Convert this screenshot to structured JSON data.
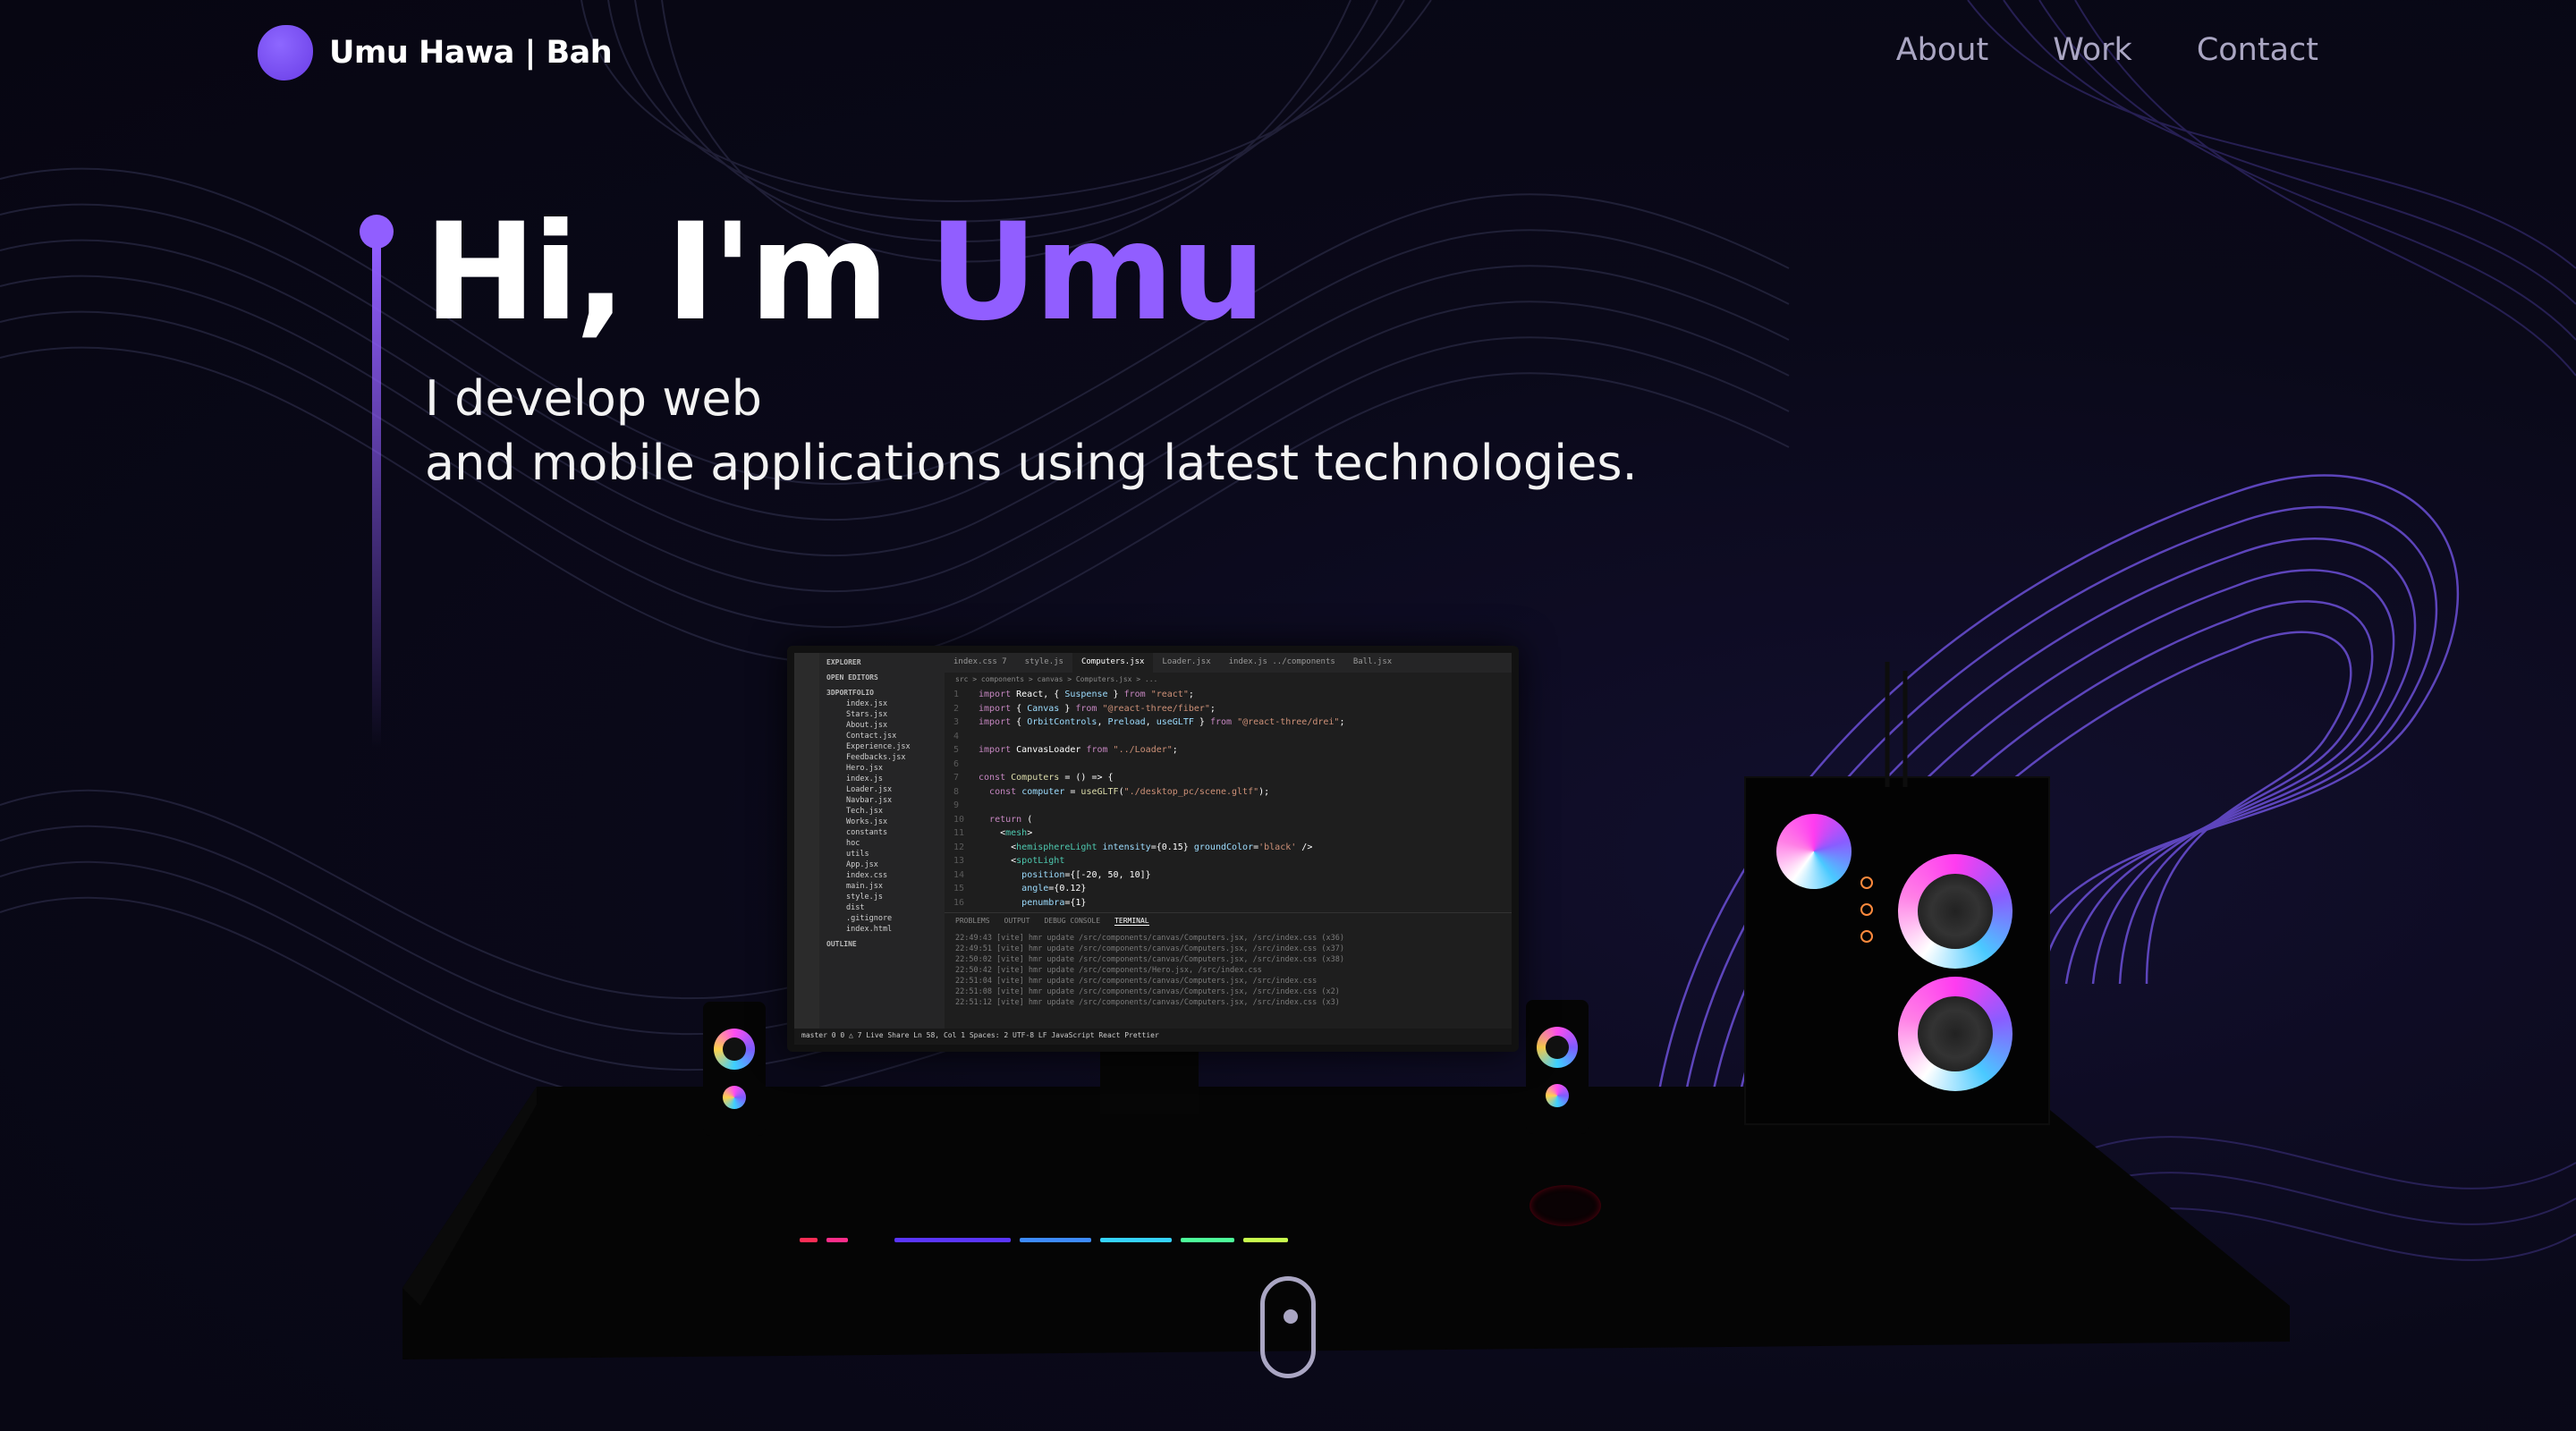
{
  "nav": {
    "logo_text": "Umu Hawa | Bah",
    "links": [
      "About",
      "Work",
      "Contact"
    ]
  },
  "hero": {
    "greeting": "Hi, I'm ",
    "name": "Umu",
    "subtitle_line1": "I develop web",
    "subtitle_line2": "and mobile applications using latest technologies."
  },
  "editor": {
    "tabs": [
      "index.css 7",
      "style.js",
      "Computers.jsx",
      "Loader.jsx",
      "index.js ../components",
      "Ball.jsx"
    ],
    "breadcrumb": "src > components > canvas > Computers.jsx > ...",
    "explorer_title": "EXPLORER",
    "open_editors": "OPEN EDITORS",
    "project": "3DPORTFOLIO",
    "files": [
      "index.jsx",
      "Stars.jsx",
      "About.jsx",
      "Contact.jsx",
      "Experience.jsx",
      "Feedbacks.jsx",
      "Hero.jsx",
      "index.js",
      "Loader.jsx",
      "Navbar.jsx",
      "Tech.jsx",
      "Works.jsx",
      "constants",
      "hoc",
      "utils",
      "App.jsx",
      "index.css",
      "main.jsx",
      "style.js",
      "dist",
      ".gitignore",
      "index.html"
    ],
    "outline": "OUTLINE",
    "panel_tabs": [
      "PROBLEMS",
      "OUTPUT",
      "DEBUG CONSOLE",
      "TERMINAL"
    ],
    "terminal_lines": [
      "22:49:43 [vite] hmr update /src/components/canvas/Computers.jsx, /src/index.css (x36)",
      "22:49:51 [vite] hmr update /src/components/canvas/Computers.jsx, /src/index.css (x37)",
      "22:50:02 [vite] hmr update /src/components/canvas/Computers.jsx, /src/index.css (x38)",
      "22:50:42 [vite] hmr update /src/components/Hero.jsx, /src/index.css",
      "22:51:04 [vite] hmr update /src/components/canvas/Computers.jsx, /src/index.css",
      "22:51:08 [vite] hmr update /src/components/canvas/Computers.jsx, /src/index.css (x2)",
      "22:51:12 [vite] hmr update /src/components/canvas/Computers.jsx, /src/index.css (x3)"
    ],
    "status_bar": "master   0 0 △ 7   Live Share                                              Ln 58, Col 1   Spaces: 2   UTF-8   LF   JavaScript React   Prettier"
  },
  "colors": {
    "accent": "#915eff",
    "nav_text": "#aaa6c3",
    "background": "#080716"
  },
  "icons": {
    "logo": "logo-blob",
    "scroll": "mouse-scroll-icon"
  }
}
